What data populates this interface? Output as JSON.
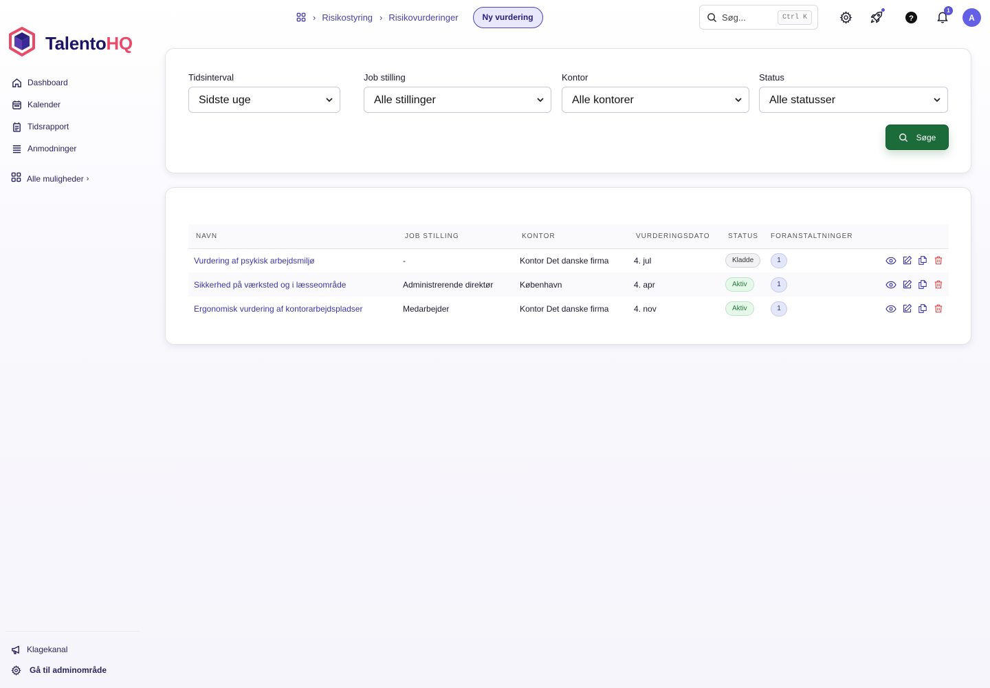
{
  "brand": {
    "name_main": "Talento",
    "name_accent": "HQ"
  },
  "sidebar": {
    "items": [
      {
        "label": "Dashboard",
        "icon": "home-icon"
      },
      {
        "label": "Kalender",
        "icon": "calendar-icon"
      },
      {
        "label": "Tidsrapport",
        "icon": "report-icon"
      },
      {
        "label": "Anmodninger",
        "icon": "list-icon"
      }
    ],
    "more_label": "Alle muligheder",
    "bottom": [
      {
        "label": "Klagekanal",
        "icon": "megaphone-icon"
      },
      {
        "label": "Gå til adminområde",
        "icon": "gear-icon"
      }
    ]
  },
  "breadcrumb": {
    "items": [
      "Risikostyring",
      "Risikovurderinger"
    ],
    "action_label": "Ny vurdering"
  },
  "search": {
    "placeholder": "Søg...",
    "shortcut": "Ctrl K"
  },
  "notifications": {
    "count": "1"
  },
  "user": {
    "initial": "A"
  },
  "filters": {
    "time": {
      "label": "Tidsinterval",
      "value": "Sidste uge"
    },
    "job": {
      "label": "Job stilling",
      "value": "Alle stillinger"
    },
    "office": {
      "label": "Kontor",
      "value": "Alle kontorer"
    },
    "status": {
      "label": "Status",
      "value": "Alle statusser"
    },
    "search_button": "Søge"
  },
  "table": {
    "columns": [
      "NAVN",
      "JOB STILLING",
      "KONTOR",
      "VURDERINGSDATO",
      "STATUS",
      "FORANSTALTNINGER"
    ],
    "rows": [
      {
        "name": "Vurdering af psykisk arbejdsmiljø",
        "job": "-",
        "office": "Kontor Det danske firma",
        "date": "4. jul",
        "status": "Kladde",
        "count": "1"
      },
      {
        "name": "Sikkerhed på værksted og i læsseområde",
        "job": "Administrerende direktør",
        "office": "København",
        "date": "4. apr",
        "status": "Aktiv",
        "count": "1"
      },
      {
        "name": "Ergonomisk vurdering af kontorarbejdspladser",
        "job": "Medarbejder",
        "office": "Kontor Det danske firma",
        "date": "4. nov",
        "status": "Aktiv",
        "count": "1"
      }
    ]
  },
  "colors": {
    "brand": "#1d1463",
    "accent": "#e84a6a",
    "primary": "#4b44b8",
    "success": "#1c6b3a",
    "danger": "#d23a3a"
  }
}
